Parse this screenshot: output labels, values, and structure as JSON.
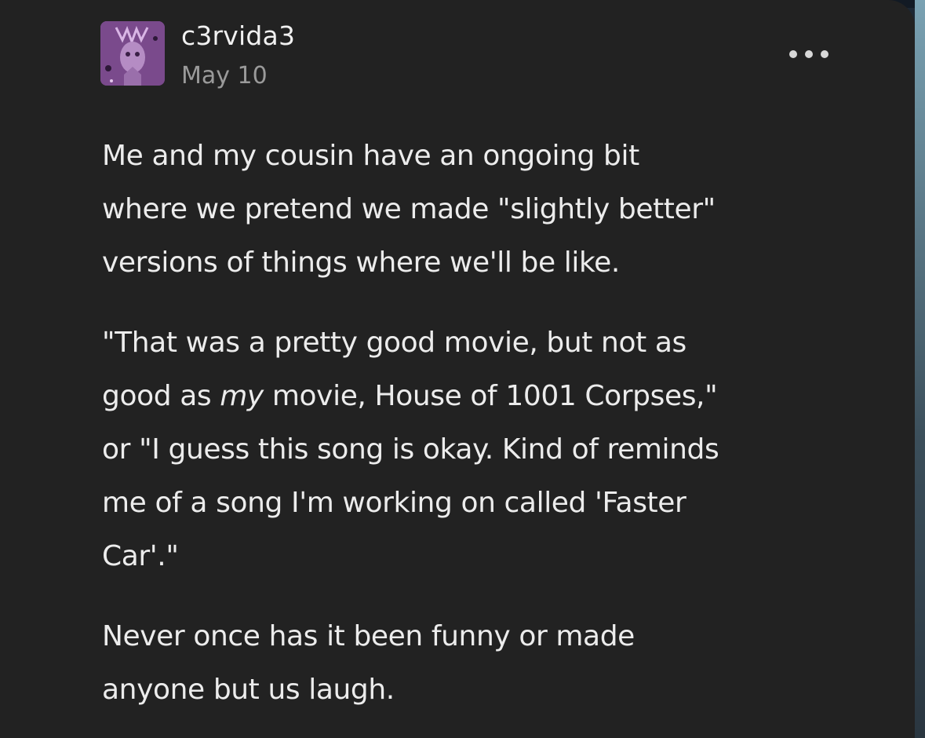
{
  "post": {
    "username": "c3rvida3",
    "date": "May 10",
    "more_icon": "ellipsis-icon",
    "avatar_icon": "avatar-image",
    "paragraphs": [
      {
        "lines": [
          "Me and my cousin have an ongoing bit",
          "where we pretend we made \"slightly better\"",
          "versions of things where we'll be like."
        ]
      },
      {
        "line1": "\"That was a pretty good movie, but not as",
        "line2_before": "good as ",
        "line2_italic": "my",
        "line2_after": " movie, House of 1001 Corpses,\"",
        "line3": "or \"I guess this song is okay. Kind of reminds",
        "line4": "me of a song I'm working on called 'Faster",
        "line5": "Car'.\""
      },
      {
        "lines": [
          "Never once has it been funny or made",
          "anyone but us laugh."
        ]
      }
    ]
  },
  "colors": {
    "card_bg": "#222222",
    "text": "#ececec",
    "muted": "#9a9a9a"
  }
}
